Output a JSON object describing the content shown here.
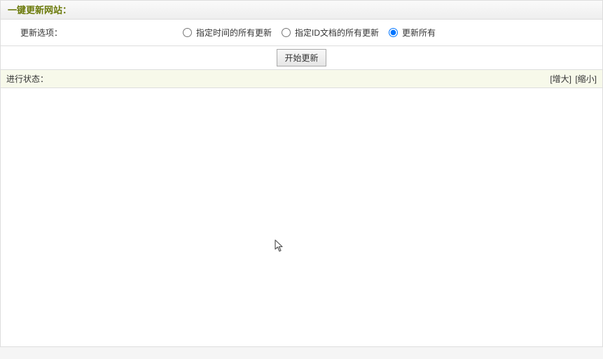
{
  "header": {
    "title": "一键更新网站："
  },
  "options": {
    "label": "更新选项：",
    "radios": [
      {
        "label": "指定时间的所有更新",
        "checked": false
      },
      {
        "label": "指定ID文档的所有更新",
        "checked": false
      },
      {
        "label": "更新所有",
        "checked": true
      }
    ]
  },
  "buttons": {
    "start": "开始更新"
  },
  "status": {
    "label": "进行状态：",
    "enlarge": "[增大]",
    "shrink": "[缩小]"
  }
}
